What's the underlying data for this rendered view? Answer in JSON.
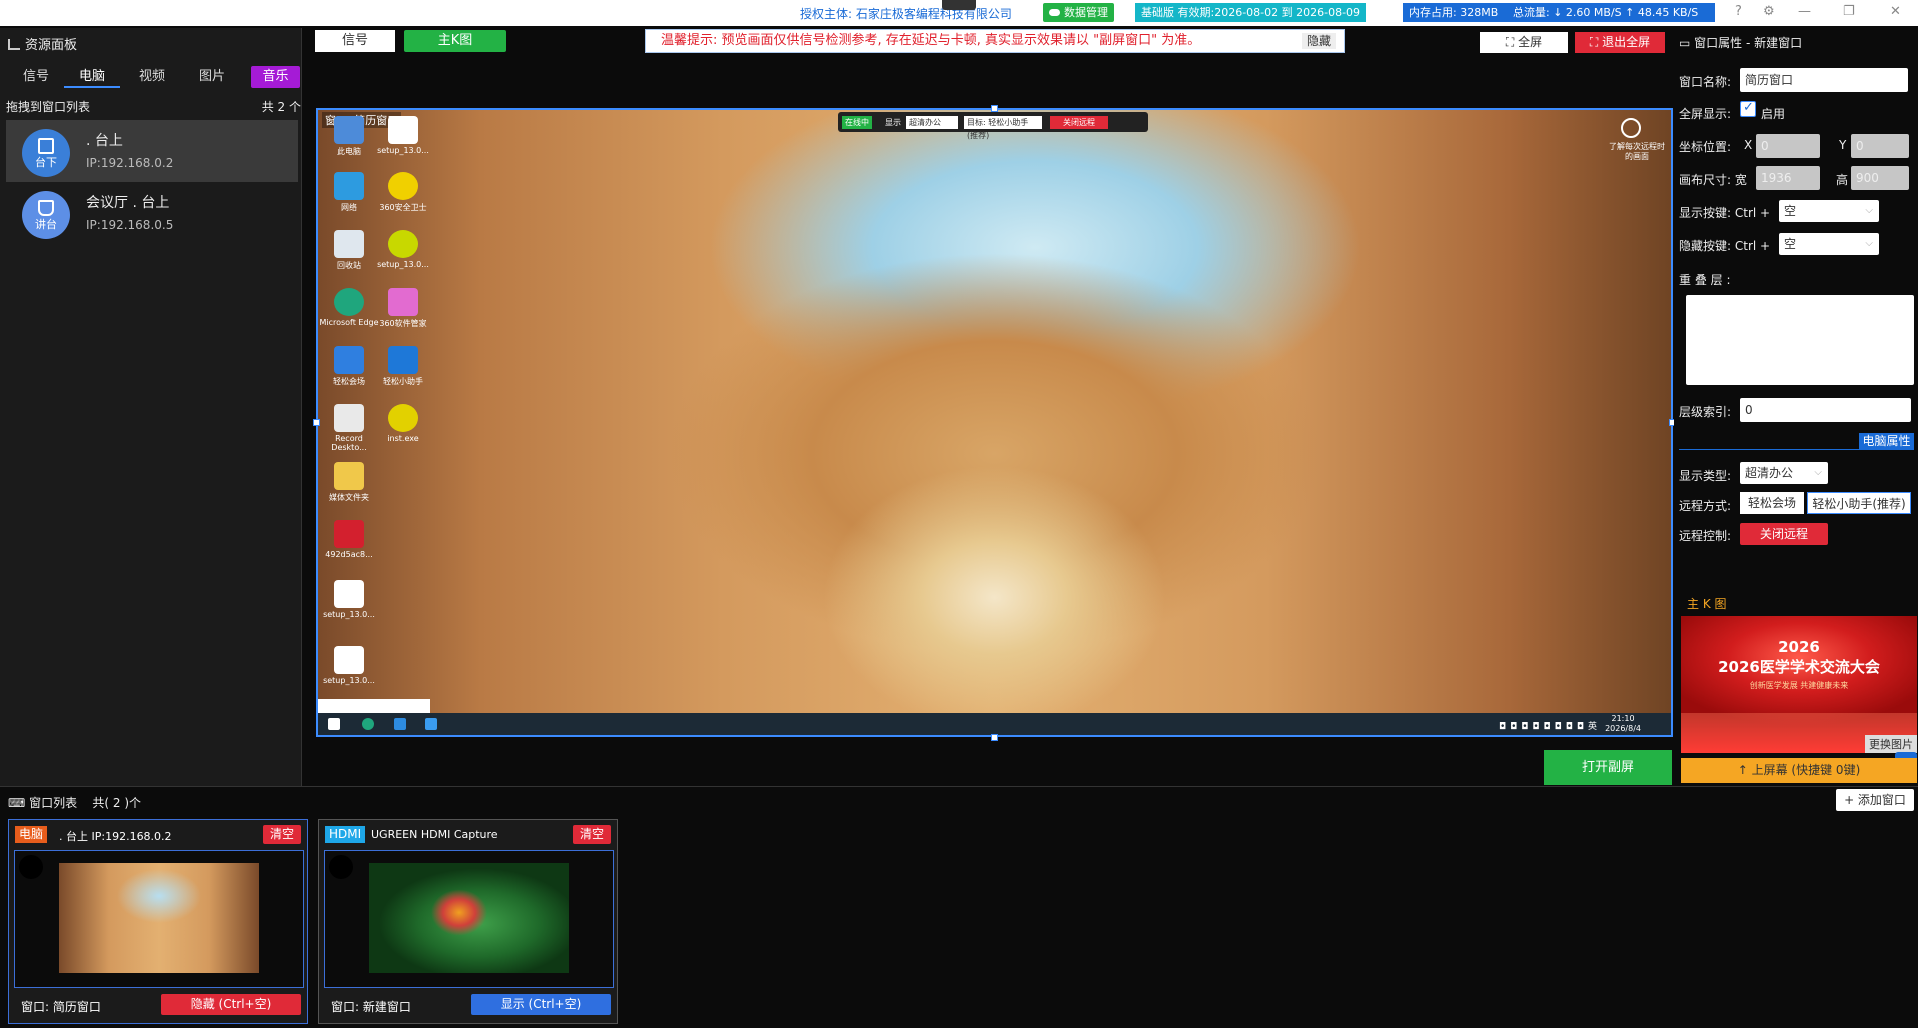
{
  "topbar": {
    "license": "授权主体: 石家庄极客编程科技有限公司",
    "data_mgmt": "数据管理",
    "edition": "基础版 有效期:2026-08-02 到 2026-08-09",
    "memory": "内存占用: 328MB",
    "traffic": "总流量: ↓ 2.60 MB/S   ↑ 48.45 KB/S"
  },
  "left": {
    "title": "资源面板",
    "tabs": [
      "信号",
      "电脑",
      "视频",
      "图片",
      "音乐"
    ],
    "drag_tip": "拖拽到窗口列表",
    "count": "共 2 个",
    "items": [
      {
        "avatar": "台下",
        "name": ". 台上",
        "ip": "IP:192.168.0.2"
      },
      {
        "avatar": "讲台",
        "name": "会议厅 . 台上",
        "ip": "IP:192.168.0.5"
      }
    ]
  },
  "center": {
    "tab_signal": "信号",
    "tab_main": "主K图",
    "notice": "温馨提示: 预览画面仅供信号检测参考, 存在延迟与卡顿, 真实显示效果请以 \"副屏窗口\" 为准。",
    "notice_hide": "隐藏",
    "fullscreen": "全屏",
    "exit_fullscreen": "退出全屏",
    "window_label": "窗口: 简历窗口",
    "remote_bar": {
      "online": "在线中",
      "display": "显示",
      "mode": "超清办公",
      "target": "目标: 轻松小助手(推荐)",
      "close": "关闭远程"
    },
    "desktop_icons": [
      "此电脑",
      "setup_13.0...",
      "网络",
      "360安全卫士",
      "回收站",
      "setup_13.0...",
      "Microsoft Edge",
      "360软件管家",
      "轻松会场",
      "轻松小助手",
      "Record Deskto...",
      "inst.exe",
      "媒体文件夹",
      "492d5ac8...",
      "setup_13.0...",
      "setup_13.0..."
    ],
    "rotate_hint": "了解每次远程时的画面",
    "clock_time": "21:10",
    "clock_date": "2026/8/4",
    "tray_lang": "英",
    "open_sub": "打开副屏"
  },
  "right": {
    "title": "窗口属性 - 新建窗口",
    "name_label": "窗口名称:",
    "name_value": "简历窗口",
    "fullscreen_label": "全屏显示:",
    "enable": "启用",
    "pos_label": "坐标位置:",
    "x_label": "X",
    "x_value": "0",
    "y_label": "Y",
    "y_value": "0",
    "size_label": "画布尺寸: 宽",
    "w_value": "1936",
    "h_label": "高",
    "h_value": "900",
    "show_key_label": "显示按键: Ctrl +",
    "show_key": "空",
    "hide_key_label": "隐藏按键: Ctrl +",
    "hide_key": "空",
    "overlay_label": "重 叠 层 :",
    "layer_label": "层级索引:",
    "layer_value": "0",
    "pc_props": "电脑属性",
    "display_type_label": "显示类型:",
    "display_type": "超清办公",
    "remote_method_label": "远程方式:",
    "remote_a": "轻松会场",
    "remote_b": "轻松小助手(推荐)",
    "remote_ctrl_label": "远程控制:",
    "close_remote": "关闭远程",
    "main_k_label": "主 K 图",
    "banner_line1": "2026",
    "banner_line2": "2026医学学术交流大会",
    "banner_sub": "创新医学发展 共建健康未来",
    "swap_image": "更换图片",
    "up_screen": "↑ 上屏幕 (快捷键 0键)"
  },
  "bottom": {
    "title": "窗口列表",
    "count": "共( 2 )个",
    "add_window": "+ 添加窗口",
    "cards": [
      {
        "badge": "电脑",
        "name": ". 台上 IP:192.168.0.2",
        "clear": "清空",
        "window": "窗口: 简历窗口",
        "action": "隐藏 (Ctrl+空)"
      },
      {
        "badge": "HDMI",
        "name": "UGREEN HDMI Capture",
        "clear": "清空",
        "window": "窗口: 新建窗口",
        "action": "显示 (Ctrl+空)"
      }
    ]
  },
  "colors": {
    "accent": "#3c8cff",
    "green": "#23b245",
    "red": "#e02a38",
    "purple": "#a51bd6",
    "orange": "#f5a623",
    "cyan": "#14b6c8",
    "blue_pill": "#1a6bd6"
  },
  "icons": [
    "chart-icon",
    "cloud-icon",
    "help-icon",
    "gear-icon",
    "minimize-icon",
    "maximize-icon",
    "close-icon",
    "fullscreen-icon",
    "exit-fullscreen-icon",
    "keyboard-icon",
    "window-icon",
    "plus-icon",
    "chevron-down-icon"
  ]
}
